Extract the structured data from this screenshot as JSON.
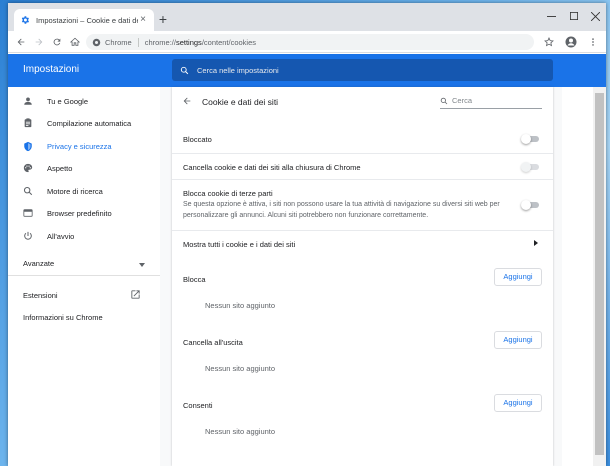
{
  "browser": {
    "tab_title": "Impostazioni – Cookie e dati dei siti",
    "newtab_label": "+",
    "site_chip": "Chrome",
    "url_prefix": "chrome://",
    "url_main": "settings",
    "url_rest": "/content/cookies"
  },
  "settings": {
    "header_title": "Impostazioni",
    "search_placeholder": "Cerca nelle impostazioni"
  },
  "sidebar": {
    "items": [
      {
        "label": "Tu e Google",
        "icon": "person-icon"
      },
      {
        "label": "Compilazione automatica",
        "icon": "clipboard-icon"
      },
      {
        "label": "Privacy e sicurezza",
        "icon": "shield-icon"
      },
      {
        "label": "Aspetto",
        "icon": "palette-icon"
      },
      {
        "label": "Motore di ricerca",
        "icon": "search-icon"
      },
      {
        "label": "Browser predefinito",
        "icon": "browser-window-icon"
      },
      {
        "label": "All'avvio",
        "icon": "power-icon"
      }
    ],
    "advanced_label": "Avanzate",
    "extensions_label": "Estensioni",
    "about_label": "Informazioni su Chrome"
  },
  "page": {
    "title": "Cookie e dati dei siti",
    "search_placeholder": "Cerca",
    "rows": {
      "blocked": "Bloccato",
      "clear_on_exit": "Cancella cookie e dati dei siti alla chiusura di Chrome",
      "third_party": "Blocca cookie di terze parti",
      "third_party_sub": "Se questa opzione è attiva, i siti non possono usare la tua attività di navigazione su diversi siti web per personalizzare gli annunci. Alcuni siti potrebbero non funzionare correttamente.",
      "see_all": "Mostra tutti i cookie e i dati dei siti"
    },
    "sections": [
      {
        "title": "Blocca",
        "button": "Aggiungi",
        "empty": "Nessun sito aggiunto"
      },
      {
        "title": "Cancella all'uscita",
        "button": "Aggiungi",
        "empty": "Nessun sito aggiunto"
      },
      {
        "title": "Consenti",
        "button": "Aggiungi",
        "empty": "Nessun sito aggiunto"
      }
    ]
  },
  "colors": {
    "accent": "#1a73e8",
    "header": "#1a73e8",
    "search_bg": "#1557b0"
  }
}
